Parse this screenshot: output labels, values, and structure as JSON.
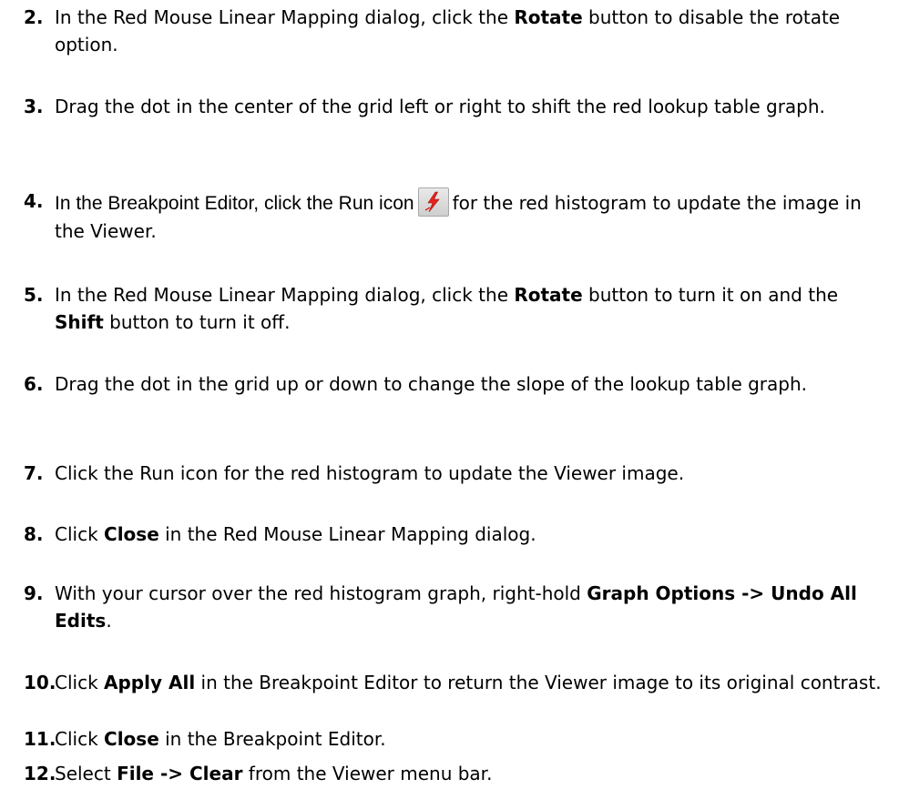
{
  "steps": [
    {
      "num": "2.",
      "parts": [
        "In the Red Mouse Linear Mapping dialog, click the ",
        "Rotate",
        " button to disable the rotate option."
      ]
    },
    {
      "num": "3.",
      "parts": [
        "Drag the dot in the center of the grid left or right to shift the red lookup table graph."
      ]
    },
    {
      "num": "4.",
      "parts": [
        "In the Breakpoint Editor, click the Run icon",
        "for the red histogram to update the image in the Viewer."
      ],
      "icon": "run-icon"
    },
    {
      "num": "5.",
      "parts": [
        "In the Red Mouse Linear Mapping dialog, click the ",
        "Rotate",
        " button to turn it on and the ",
        "Shift",
        " button to turn it off."
      ]
    },
    {
      "num": "6.",
      "parts": [
        "Drag the dot in the grid up or down to change the slope of the lookup table graph."
      ]
    },
    {
      "num": "7.",
      "parts": [
        "Click the Run icon for the red histogram to update the Viewer image."
      ]
    },
    {
      "num": "8.",
      "parts": [
        "Click ",
        "Close",
        " in the Red Mouse Linear Mapping dialog."
      ]
    },
    {
      "num": "9.",
      "parts": [
        "With your cursor over the red histogram graph, right-hold ",
        "Graph Options -> Undo All Edits",
        "."
      ]
    },
    {
      "num": "10.",
      "parts": [
        "Click ",
        "Apply All",
        " in the Breakpoint Editor to return the Viewer image to its original contrast."
      ]
    },
    {
      "num": "11.",
      "parts": [
        "Click ",
        "Close",
        " in the Breakpoint Editor."
      ]
    },
    {
      "num": "12.",
      "parts": [
        "Select ",
        "File -> Clear",
        " from the Viewer menu bar."
      ]
    }
  ]
}
